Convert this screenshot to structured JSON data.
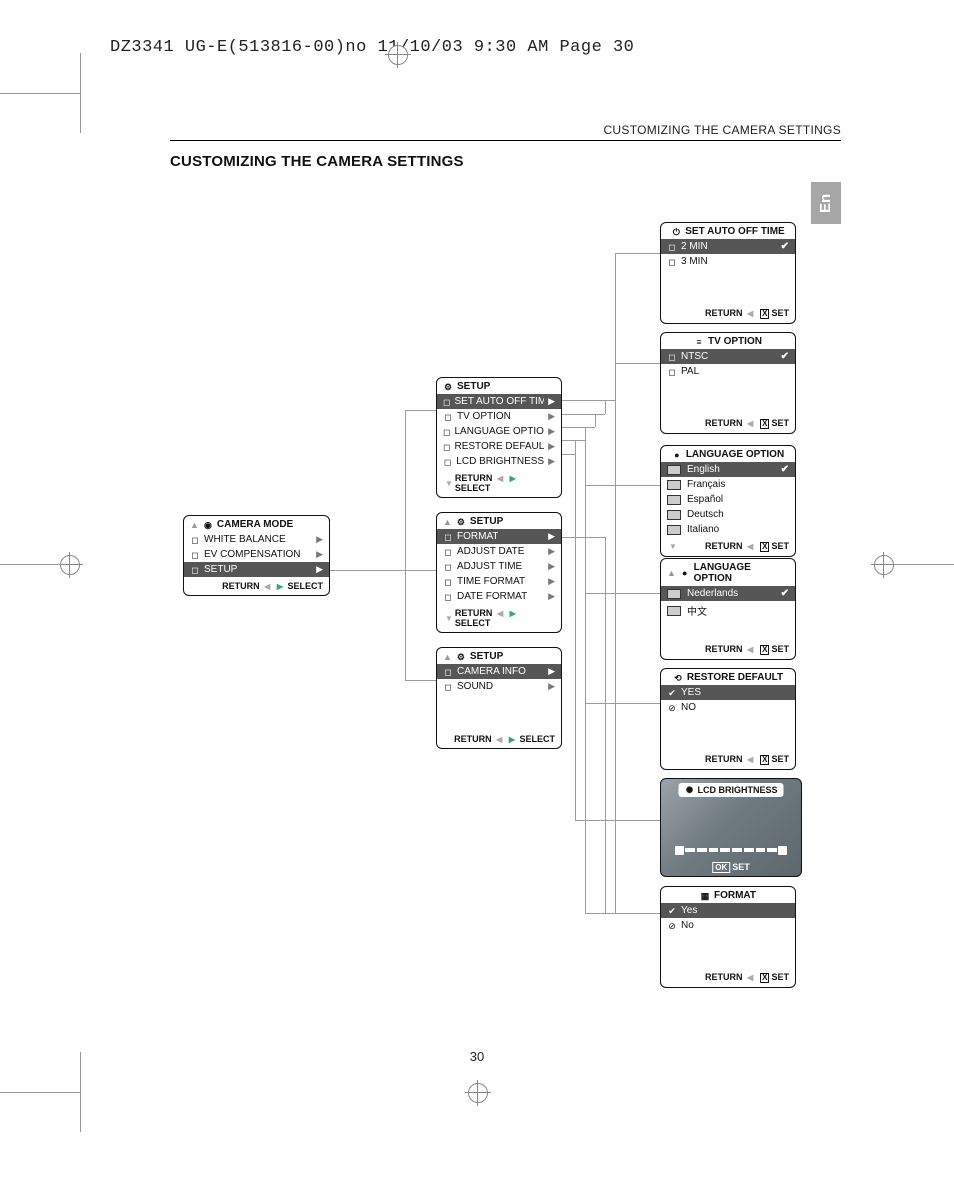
{
  "prepress_line": "DZ3341 UG-E(513816-00)no  11/10/03  9:30 AM  Page 30",
  "running_head": "CUSTOMIZING THE CAMERA SETTINGS",
  "section_title": "CUSTOMIZING THE CAMERA SETTINGS",
  "lang_tab": "En",
  "page_number": "30",
  "foot": {
    "return": "RETURN",
    "select": "SELECT",
    "set": "SET",
    "x": "X",
    "ok": "OK"
  },
  "camera_mode": {
    "title": "CAMERA MODE",
    "items": [
      {
        "label": "WHITE BALANCE"
      },
      {
        "label": "EV COMPENSATION"
      },
      {
        "label": "SETUP",
        "selected": true
      }
    ]
  },
  "setup1": {
    "title": "SETUP",
    "items": [
      {
        "label": "SET AUTO OFF TIME",
        "selected": true
      },
      {
        "label": "TV OPTION"
      },
      {
        "label": "LANGUAGE OPTION"
      },
      {
        "label": "RESTORE DEFAULT"
      },
      {
        "label": "LCD BRIGHTNESS"
      }
    ]
  },
  "setup2": {
    "title": "SETUP",
    "items": [
      {
        "label": "FORMAT",
        "selected": true
      },
      {
        "label": "ADJUST DATE"
      },
      {
        "label": "ADJUST TIME"
      },
      {
        "label": "TIME FORMAT"
      },
      {
        "label": "DATE FORMAT"
      }
    ]
  },
  "setup3": {
    "title": "SETUP",
    "items": [
      {
        "label": "CAMERA INFO",
        "selected": true
      },
      {
        "label": "SOUND"
      }
    ]
  },
  "auto_off": {
    "title": "SET AUTO OFF TIME",
    "items": [
      {
        "label": "2 MIN",
        "selected": true
      },
      {
        "label": "3 MIN"
      }
    ]
  },
  "tv_option": {
    "title": "TV  OPTION",
    "items": [
      {
        "label": "NTSC",
        "selected": true
      },
      {
        "label": "PAL"
      }
    ]
  },
  "lang1": {
    "title": "LANGUAGE  OPTION",
    "items": [
      {
        "label": "English",
        "selected": true
      },
      {
        "label": "Français"
      },
      {
        "label": "Español"
      },
      {
        "label": "Deutsch"
      },
      {
        "label": "Italiano"
      }
    ]
  },
  "lang2": {
    "title": "LANGUAGE  OPTION",
    "items": [
      {
        "label": "Nederlands",
        "selected": true
      },
      {
        "label": "中文"
      }
    ]
  },
  "restore": {
    "title": "RESTORE DEFAULT",
    "items": [
      {
        "label": "YES",
        "selected": true
      },
      {
        "label": "NO"
      }
    ]
  },
  "brightness": {
    "title": "LCD BRIGHTNESS"
  },
  "format": {
    "title": "FORMAT",
    "items": [
      {
        "label": "Yes",
        "selected": true
      },
      {
        "label": "No"
      }
    ]
  }
}
